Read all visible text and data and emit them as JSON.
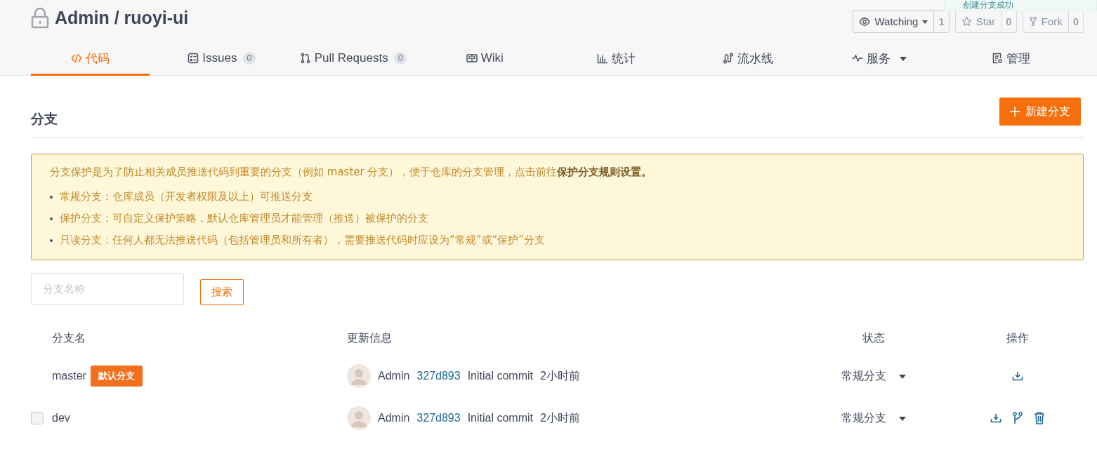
{
  "repo": {
    "title": "Admin / ruoyi-ui"
  },
  "toast": {
    "message": "创建分支成功"
  },
  "repo_actions": [
    {
      "kind": "watch",
      "label": "Watching",
      "count": "1"
    },
    {
      "kind": "star",
      "label": "Star",
      "count": "0"
    },
    {
      "kind": "fork",
      "label": "Fork",
      "count": "0"
    }
  ],
  "tabs": [
    {
      "label": "代码",
      "selected": true
    },
    {
      "label": "Issues",
      "count": "0",
      "selected": false
    },
    {
      "label": "Pull Requests",
      "count": "0",
      "selected": false
    },
    {
      "label": "Wiki",
      "selected": false
    },
    {
      "label": "统计",
      "selected": false
    },
    {
      "label": "流水线",
      "selected": false
    },
    {
      "label": "服务",
      "dropdown": true,
      "selected": false
    },
    {
      "label": "管理",
      "selected": false
    }
  ],
  "section": {
    "title": "分支",
    "new_button": "新建分支"
  },
  "notice": {
    "intro": "分支保护是为了防止相关成员推送代码到重要的分支（例如 master 分支），便于仓库的分支管理，点击前往**保护分支规则设置。**",
    "items": [
      "常规分支：仓库成员（开发者权限及以上）可推送分支",
      "保护分支：可自定义保护策略，默认仓库管理员才能管理（推送）被保护的分支",
      "只读分支：任何人都无法推送代码（包括管理员和所有者），需要推送代码时应设为“常规”或“保护”分支"
    ]
  },
  "search": {
    "placeholder": "分支名称",
    "button": "搜索"
  },
  "table": {
    "columns": [
      "分支名",
      "更新信息",
      "状态",
      "操作"
    ],
    "rows": [
      {
        "branch": "master",
        "badge": "默认分支",
        "author": "Admin",
        "commit": "327d893",
        "message": "Initial commit",
        "time": "2小时前",
        "status": "常规分支",
        "actions": [
          {
            "kind": "download"
          }
        ]
      },
      {
        "branch": "dev",
        "checkbox": {
          "checked": false
        },
        "author": "Admin",
        "commit": "327d893",
        "message": "Initial commit",
        "time": "2小时前",
        "status": "常规分支",
        "actions": [
          {
            "kind": "download"
          },
          {
            "kind": "branch"
          },
          {
            "kind": "delete"
          }
        ]
      }
    ]
  }
}
